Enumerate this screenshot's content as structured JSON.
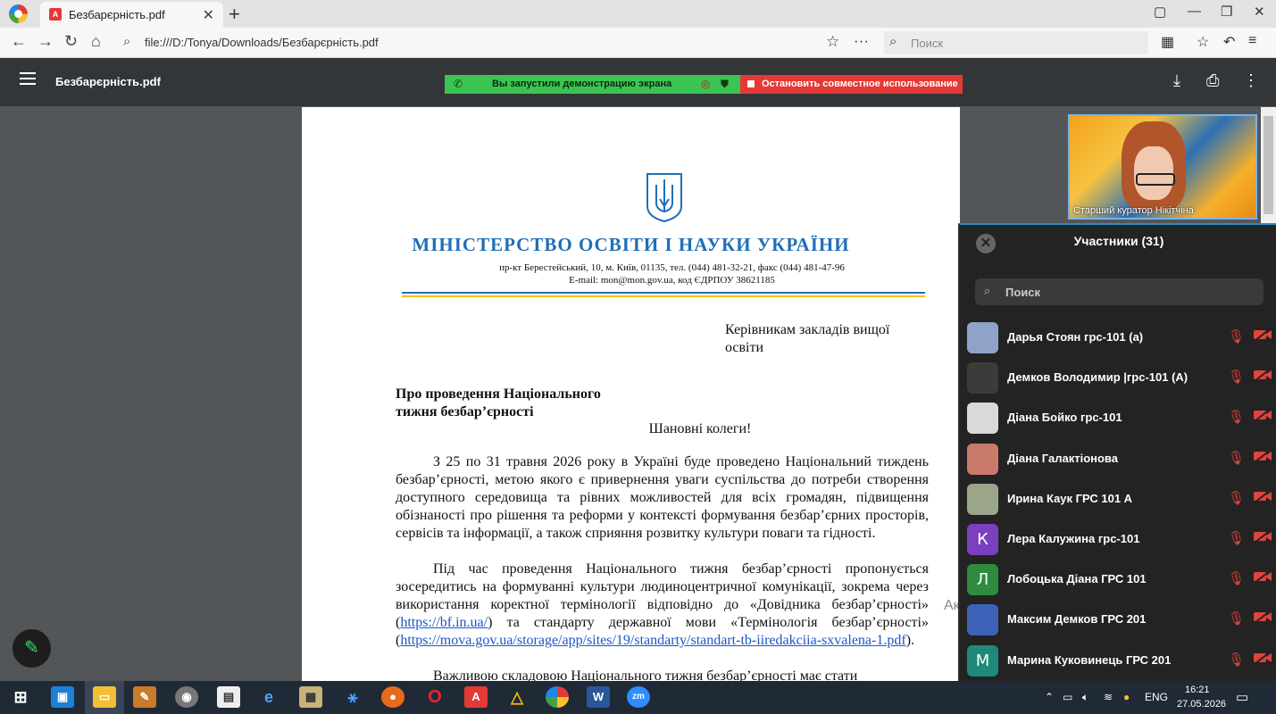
{
  "browser": {
    "tab_title": "Безбарєрність.pdf",
    "url": "file:///D:/Tonya/Downloads/Безбарєрність.pdf",
    "search_placeholder": "Поиск"
  },
  "pdf_toolbar": {
    "title": "Безбарєрність.pdf"
  },
  "screen_share": {
    "status_text": "Вы запустили демонстрацию экрана",
    "stop_label": "Остановить совместное использование"
  },
  "document": {
    "ministry": "МІНІСТЕРСТВО ОСВІТИ І НАУКИ УКРАЇНИ",
    "address_line1": "пр-кт Берестейський, 10, м. Київ, 01135, тел. (044) 481-32-21, факс (044) 481-47-96",
    "address_line2": "E-mail: mon@mon.gov.ua, код ЄДРПОУ 38621185",
    "recipient": "Керівникам закладів вищої освіти",
    "subject_line1": "Про проведення Національного",
    "subject_line2": "тижня безбар’єрності",
    "greeting": "Шановні колеги!",
    "para1": "З 25 по 31 травня 2026 року в Україні буде проведено Національний тиждень безбар’єрності, метою якого є привернення уваги суспільства до потреби створення доступного середовища та рівних можливостей для всіх громадян, підвищення обізнаності про рішення та реформи у контексті формування безбар’єрних просторів, сервісів та інформації, а також сприяння розвитку культури поваги та гідності.",
    "para2_a": "Під час проведення Національного тижня безбар’єрності пропонується зосередитись на формуванні культури людиноцентричної комунікації, зокрема через використання коректної термінології відповідно до «Довідника безбар’єрності» (",
    "para2_link1": "https://bf.in.ua/",
    "para2_b": ") та стандарту державної мови «Термінологія безбар’єрності» (",
    "para2_link2": "https://mova.gov.ua/storage/app/sites/19/standarty/standart-tb-iiredakciia-sxvalena-1.pdf",
    "para2_c": ").",
    "para3": "Важливою складовою Національного тижня безбар’єрності має стати"
  },
  "video": {
    "label": "Старший куратор Нікітчіна"
  },
  "participants_panel": {
    "title": "Участники (31)",
    "search_placeholder": "Поиск",
    "participants": [
      {
        "name": "Дарья Стоян грс-101 (а)",
        "avatar": "",
        "color": "#8fa3c9"
      },
      {
        "name": "Демков Володимир |грс-101 (А)",
        "avatar": "",
        "color": "#3b3b3b"
      },
      {
        "name": "Діана Бойко грс-101",
        "avatar": "",
        "color": "#d9d9d9"
      },
      {
        "name": "Діана Галактіонова",
        "avatar": "",
        "color": "#c97a6b"
      },
      {
        "name": "Ирина Каук ГРС 101 А",
        "avatar": "",
        "color": "#9aa58a"
      },
      {
        "name": "Лера Калужина грс-101",
        "avatar": "К",
        "color": "#7b3fbf"
      },
      {
        "name": "Лобоцька Діана ГРС 101",
        "avatar": "Л",
        "color": "#2e8b3f"
      },
      {
        "name": "Максим Демков ГРС 201",
        "avatar": "",
        "color": "#3c63b8"
      },
      {
        "name": "Марина Куковинець ГРС 201",
        "avatar": "М",
        "color": "#1f8a79"
      }
    ]
  },
  "background_text": "Ак",
  "taskbar": {
    "language": "ENG",
    "time": "16:21",
    "date": "27.05.2026"
  },
  "colors": {
    "ministry_blue": "#1f6fb8",
    "share_green": "#3cc453",
    "stop_red": "#e53935",
    "muted_red": "#e0443c"
  }
}
